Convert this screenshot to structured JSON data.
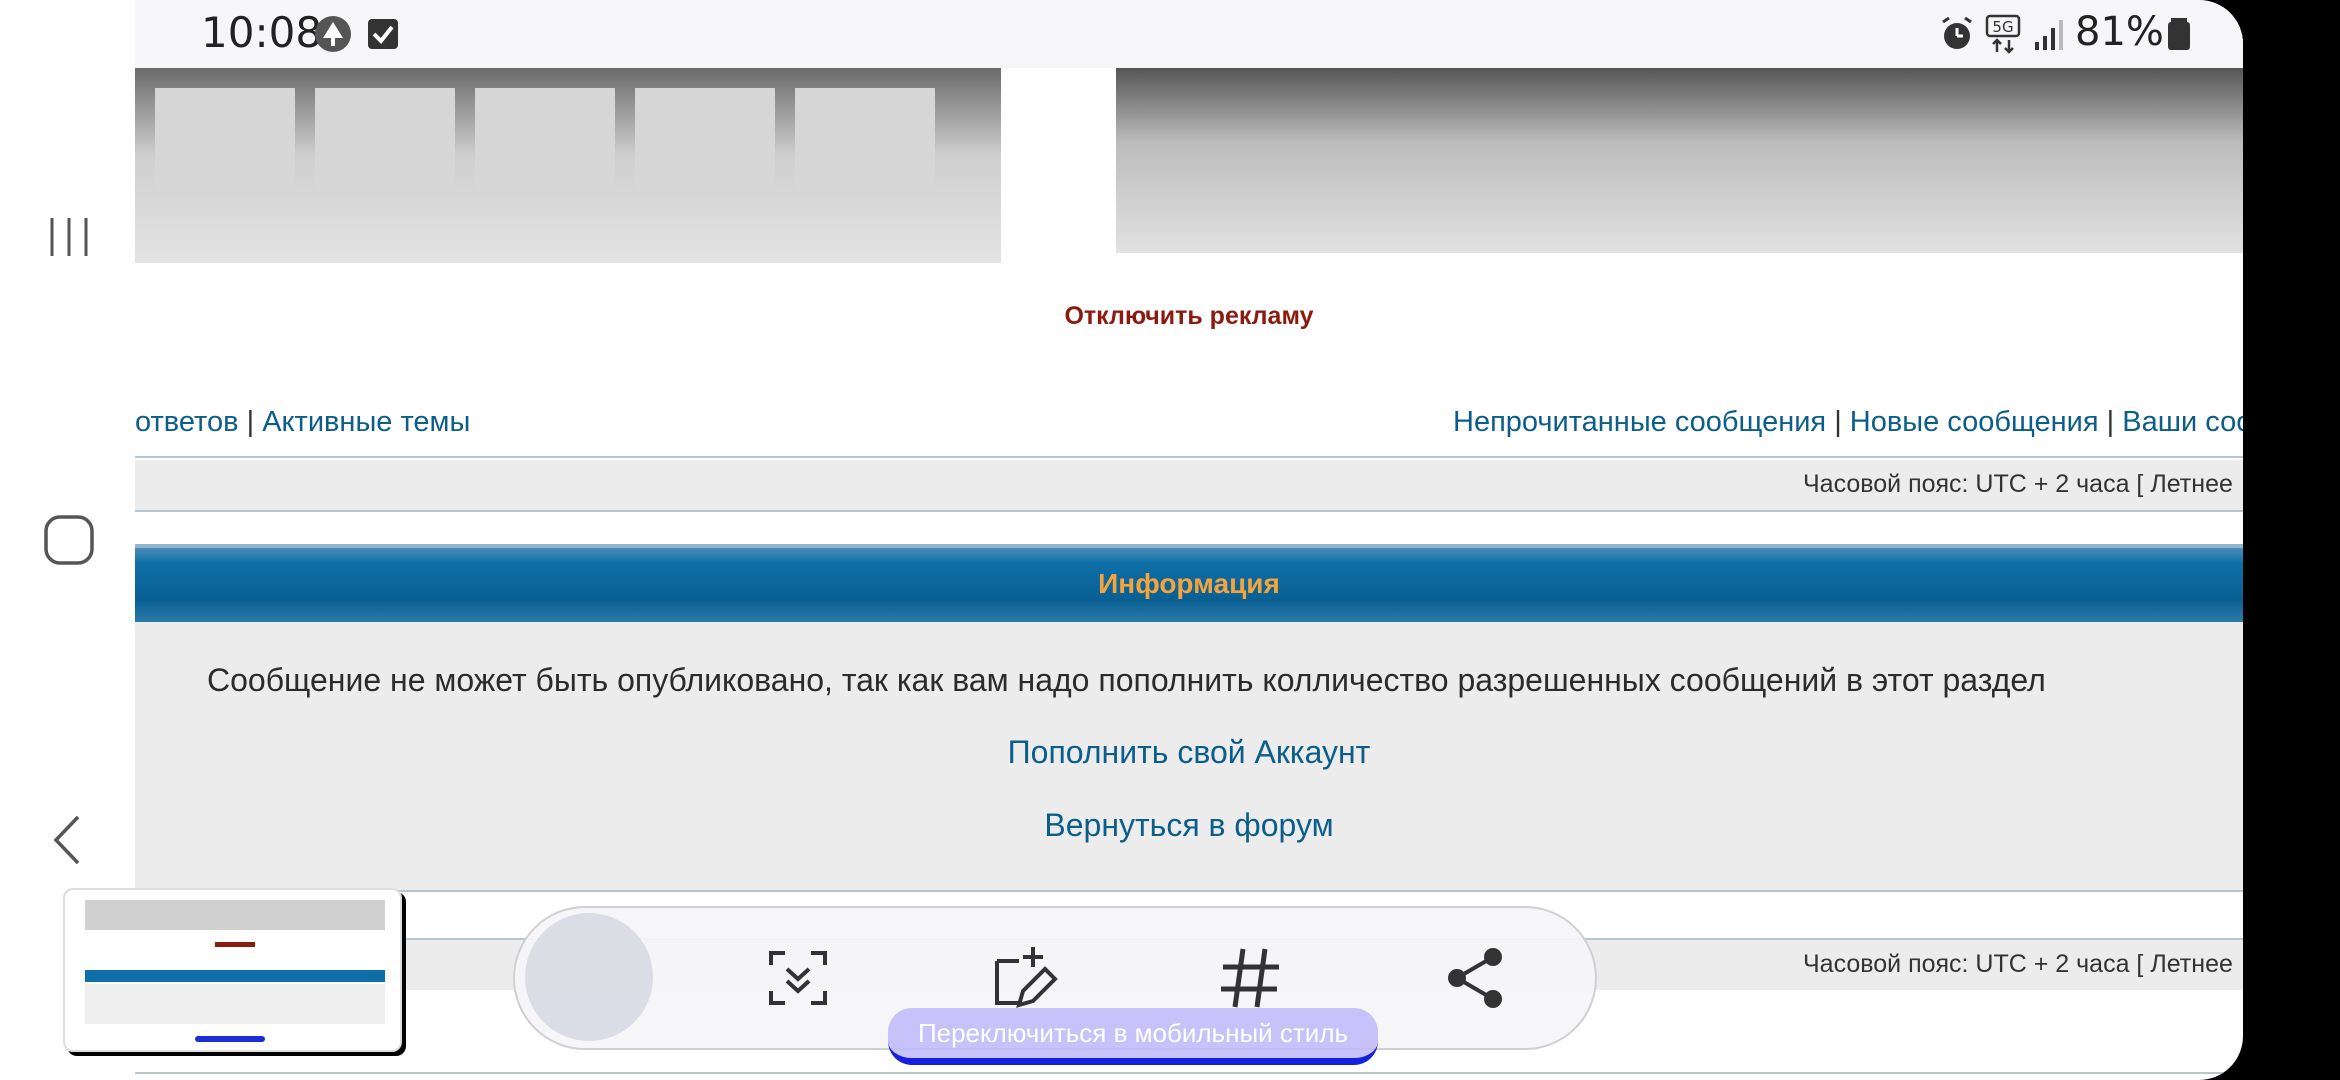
{
  "status_bar": {
    "time": "10:08",
    "battery": "81%",
    "network": "5G",
    "icons": [
      "tree-app-icon",
      "checkbox-notification-icon",
      "alarm-icon",
      "5g-data-icon",
      "signal-icon",
      "battery-icon"
    ]
  },
  "nav_bar": {
    "icons": [
      "recent-apps-icon",
      "home-icon",
      "back-icon"
    ]
  },
  "ads": {
    "disable_label": "Отключить рекламу"
  },
  "nav_links": {
    "left": [
      "ответов",
      "Активные темы"
    ],
    "right": [
      "Непрочитанные сообщения",
      "Новые сообщения",
      "Ваши сообщения"
    ],
    "separator": "|"
  },
  "timezone": {
    "text": "Часовой пояс: UTC + 2 часа [ Летнее"
  },
  "info": {
    "title": "Информация",
    "message": "Сообщение не может быть опубликовано, так как вам надо пополнить колличество разрешенных сообщений в этот раздел",
    "topup_link": "Пополнить свой Аккаунт",
    "back_link": "Вернуться в форум"
  },
  "screenshot_toolbar": {
    "buttons": [
      "scroll-capture-icon",
      "edit-crop-icon",
      "hashtag-icon",
      "share-icon"
    ]
  },
  "mobile_style_button": "Переключиться в мобильный стиль",
  "colors": {
    "link": "#0b5d8a",
    "ad_link": "#8b1b0e",
    "info_header": "#0e6fa8",
    "info_title": "#f4a43b",
    "mobile_button": "#1520e0"
  }
}
